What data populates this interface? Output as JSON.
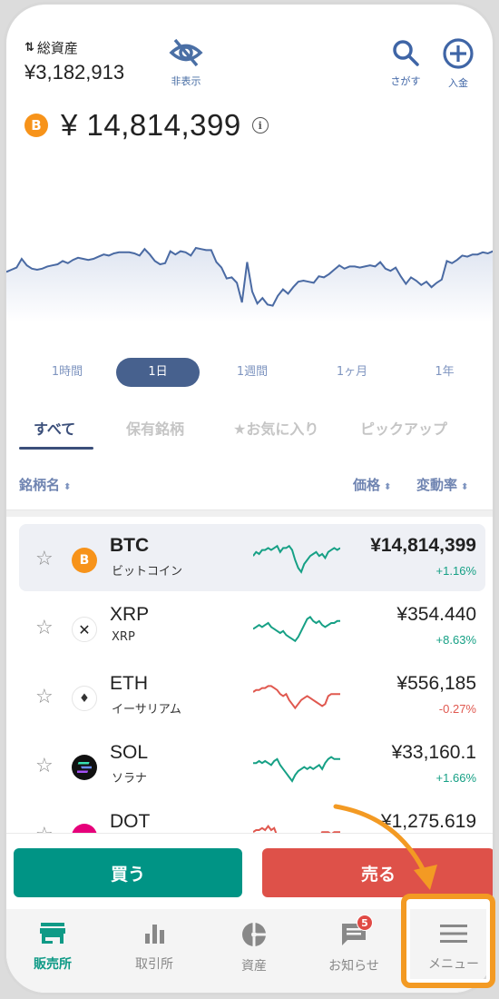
{
  "header": {
    "total_assets_label": "総資産",
    "total_assets_value": "¥3,182,913",
    "hide_label": "非表示",
    "search_label": "さがす",
    "deposit_label": "入金"
  },
  "selected_coin": {
    "symbol_glyph": "B",
    "price": "¥ 14,814,399"
  },
  "main_chart_series": [
    62,
    60,
    58,
    50,
    56,
    59,
    60,
    59,
    57,
    56,
    55,
    52,
    54,
    51,
    49,
    50,
    51,
    50,
    48,
    46,
    47,
    45,
    44,
    44,
    44,
    45,
    47,
    41,
    46,
    52,
    55,
    54,
    43,
    46,
    43,
    44,
    47,
    40,
    41,
    42,
    42,
    53,
    58,
    68,
    67,
    72,
    90,
    53,
    80,
    91,
    86,
    92,
    93,
    84,
    78,
    82,
    76,
    71,
    70,
    71,
    72,
    66,
    67,
    64,
    60,
    56,
    59,
    57,
    57,
    58,
    57,
    56,
    57,
    53,
    59,
    61,
    58,
    66,
    73,
    67,
    70,
    74,
    71,
    76,
    72,
    69,
    52,
    54,
    51,
    47,
    48,
    46,
    46,
    44,
    45,
    43,
    42
  ],
  "periods": [
    {
      "label": "1時間",
      "active": false
    },
    {
      "label": "1日",
      "active": true
    },
    {
      "label": "1週間",
      "active": false
    },
    {
      "label": "1ヶ月",
      "active": false
    },
    {
      "label": "1年",
      "active": false
    }
  ],
  "tabs": [
    {
      "label": "すべて",
      "active": true
    },
    {
      "label": "保有銘柄",
      "active": false
    },
    {
      "label": "★お気に入り",
      "active": false
    },
    {
      "label": "ピックアップ",
      "active": false
    }
  ],
  "sort": {
    "name_label": "銘柄名",
    "price_label": "価格",
    "change_label": "変動率",
    "arrows": "⬍"
  },
  "coins": [
    {
      "symbol": "BTC",
      "name": "ビットコイン",
      "price": "¥14,814,399",
      "change": "+1.16%",
      "direction": "up",
      "icon_color": "#f7931a",
      "spark": [
        6,
        4,
        5,
        3,
        3,
        2,
        3,
        2,
        1,
        4,
        2,
        2,
        1,
        3,
        8,
        12,
        14,
        10,
        8,
        6,
        5,
        4,
        6,
        5,
        7,
        4,
        3,
        2,
        3,
        2
      ]
    },
    {
      "symbol": "XRP",
      "name": "XRP",
      "price": "¥354.440",
      "change": "+8.63%",
      "direction": "up",
      "icon_color": "#ffffff",
      "spark": [
        8,
        7,
        6,
        7,
        6,
        5,
        7,
        8,
        9,
        10,
        9,
        11,
        12,
        13,
        14,
        12,
        9,
        6,
        3,
        2,
        4,
        5,
        4,
        6,
        7,
        6,
        5,
        5,
        4,
        4
      ]
    },
    {
      "symbol": "ETH",
      "name": "イーサリアム",
      "price": "¥556,185",
      "change": "-0.27%",
      "direction": "down",
      "icon_color": "#ffffff",
      "spark": [
        5,
        4,
        4,
        3,
        3,
        2,
        2,
        3,
        4,
        6,
        7,
        6,
        9,
        11,
        13,
        11,
        9,
        8,
        7,
        8,
        9,
        10,
        11,
        12,
        11,
        7,
        6,
        6,
        6,
        6
      ]
    },
    {
      "symbol": "SOL",
      "name": "ソラナ",
      "price": "¥33,160.1",
      "change": "+1.66%",
      "direction": "up",
      "icon_color": "#111111",
      "spark": [
        6,
        6,
        5,
        6,
        5,
        6,
        7,
        5,
        4,
        7,
        9,
        11,
        13,
        15,
        12,
        10,
        9,
        8,
        9,
        8,
        9,
        8,
        7,
        9,
        6,
        4,
        3,
        4,
        4,
        4
      ]
    },
    {
      "symbol": "DOT",
      "name": "",
      "price": "¥1,275.619",
      "change": "",
      "direction": "down",
      "icon_color": "#e6007a",
      "spark": [
        6,
        5,
        5,
        4,
        5,
        3,
        5,
        4,
        8,
        7,
        9,
        12,
        14,
        13,
        10,
        9,
        8,
        7,
        8,
        7,
        9,
        10,
        9,
        6,
        6,
        6,
        7,
        6,
        6,
        6
      ]
    }
  ],
  "actions": {
    "buy_label": "買う",
    "sell_label": "売る"
  },
  "nav": [
    {
      "label": "販売所",
      "icon": "store-icon",
      "active": true
    },
    {
      "label": "取引所",
      "icon": "bar-chart-icon",
      "active": false
    },
    {
      "label": "資産",
      "icon": "pie-chart-icon",
      "active": false
    },
    {
      "label": "お知らせ",
      "icon": "message-icon",
      "active": false,
      "badge": "5"
    },
    {
      "label": "メニュー",
      "icon": "menu-icon",
      "active": false
    }
  ],
  "colors": {
    "accent": "#47618e",
    "up": "#16a085",
    "down": "#e0584f",
    "buy": "#009485",
    "sell": "#de5149",
    "highlight": "#f39a23"
  }
}
